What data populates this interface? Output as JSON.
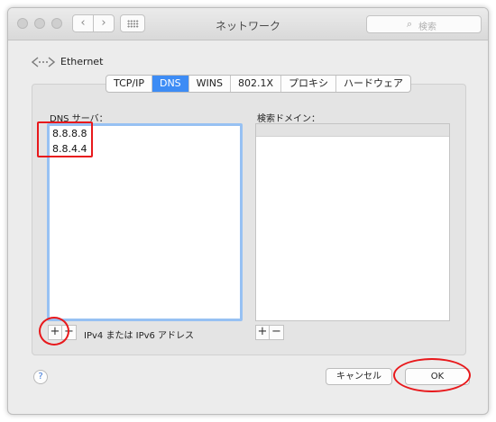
{
  "window": {
    "title": "ネットワーク",
    "search": {
      "placeholder": "検索"
    }
  },
  "interface": {
    "name": "Ethernet"
  },
  "tabs": [
    {
      "label": "TCP/IP",
      "active": false
    },
    {
      "label": "DNS",
      "active": true
    },
    {
      "label": "WINS",
      "active": false
    },
    {
      "label": "802.1X",
      "active": false
    },
    {
      "label": "プロキシ",
      "active": false
    },
    {
      "label": "ハードウェア",
      "active": false
    }
  ],
  "dns_servers": {
    "label": "DNS サーバ：",
    "entries": [
      "8.8.8.8",
      "8.8.4.4"
    ],
    "hint": "IPv4 または IPv6 アドレス"
  },
  "search_domains": {
    "label": "検索ドメイン：",
    "entries": []
  },
  "controls": {
    "plus": "+",
    "minus": "−",
    "help": "?",
    "cancel": "キャンセル",
    "ok": "OK"
  },
  "icons": [
    "back-icon",
    "forward-icon",
    "grid-icon",
    "search-icon",
    "ethernet-icon",
    "help-icon"
  ],
  "colors": {
    "active_tab": "#3d8cf5",
    "focus_ring": "#97c1f3",
    "annotation": "#e8191c"
  }
}
